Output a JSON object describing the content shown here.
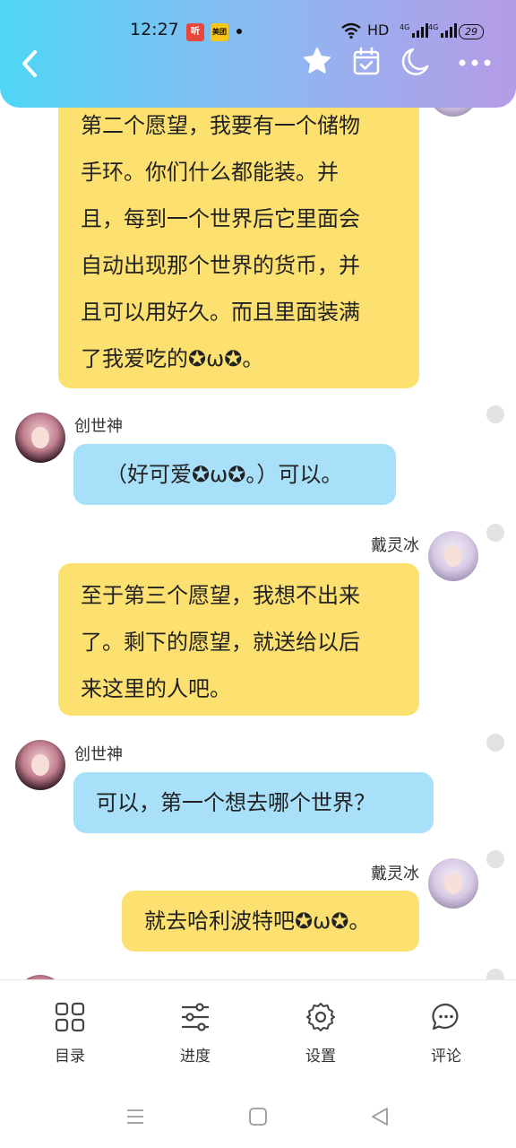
{
  "status_bar": {
    "time": "12:27",
    "app_badge_1": "听",
    "app_badge_2": "美团",
    "hd_label": "HD",
    "net_1": "4G",
    "net_2": "4G",
    "battery": "29"
  },
  "header": {
    "back_icon": "chevron-left",
    "actions": [
      "star",
      "calendar-check",
      "moon",
      "more"
    ]
  },
  "messages": [
    {
      "side": "right",
      "color": "yellow",
      "sender": "",
      "lines": [
        "第二个愿望，我要有一个储物",
        "手环。你们什么都能装。并",
        "且，每到一个世界后它里面会",
        "自动出现那个世界的货币，并",
        "且可以用好久。而且里面装满",
        "了我爱吃的✪ω✪。"
      ]
    },
    {
      "side": "left",
      "color": "blue",
      "sender": "创世神",
      "lines": [
        "（好可爱✪ω✪。）可以。"
      ]
    },
    {
      "side": "right",
      "color": "yellow",
      "sender": "戴灵冰",
      "lines": [
        "至于第三个愿望，我想不出来",
        "了。剩下的愿望，就送给以后",
        "来这里的人吧。"
      ]
    },
    {
      "side": "left",
      "color": "blue",
      "sender": "创世神",
      "lines": [
        "可以，第一个想去哪个世界？"
      ]
    },
    {
      "side": "right",
      "color": "yellow",
      "sender": "戴灵冰",
      "lines": [
        "就去哈利波特吧✪ω✪。"
      ]
    }
  ],
  "bottom_nav": [
    {
      "label": "目录",
      "icon": "grid-icon"
    },
    {
      "label": "进度",
      "icon": "sliders-icon"
    },
    {
      "label": "设置",
      "icon": "gear-icon"
    },
    {
      "label": "评论",
      "icon": "comment-icon"
    }
  ],
  "colors": {
    "bubble_blue": "#a8dff9",
    "bubble_yellow": "#fde170",
    "header_start": "#4fd6f5",
    "header_end": "#b59be6"
  }
}
